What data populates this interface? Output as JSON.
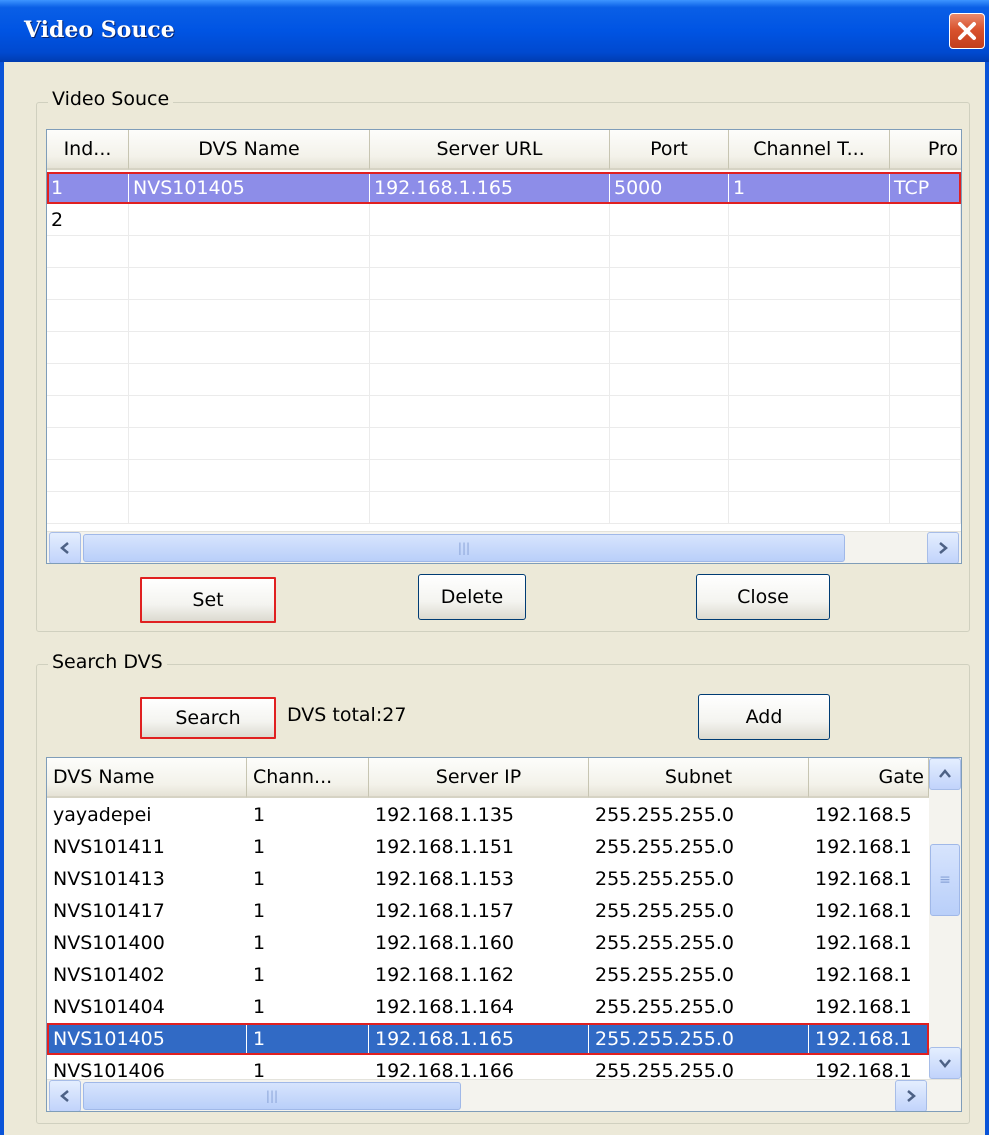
{
  "window": {
    "title": "Video Souce",
    "close_icon": "close-icon"
  },
  "video_source": {
    "group_label": "Video Souce",
    "columns": [
      "Ind...",
      "DVS Name",
      "Server URL",
      "Port",
      "Channel T...",
      "Pro"
    ],
    "rows": [
      [
        "1",
        "NVS101405",
        "192.168.1.165",
        "5000",
        "1",
        "TCP"
      ],
      [
        "2",
        "",
        "",
        "",
        "",
        ""
      ]
    ],
    "selected_row": 1,
    "empty_rows": 9,
    "buttons": {
      "set": "Set",
      "delete": "Delete",
      "close": "Close"
    },
    "scroll_grip": "|||"
  },
  "search_dvs": {
    "group_label": "Search DVS",
    "search_label": "Search",
    "total_text": "DVS total:27",
    "add_label": "Add",
    "columns": [
      "DVS Name",
      "Chann...",
      "Server IP",
      "Subnet",
      "Gate"
    ],
    "rows": [
      [
        "yayadepei",
        "1",
        "192.168.1.135",
        "255.255.255.0",
        "192.168.5"
      ],
      [
        "NVS101411",
        "1",
        "192.168.1.151",
        "255.255.255.0",
        "192.168.1"
      ],
      [
        "NVS101413",
        "1",
        "192.168.1.153",
        "255.255.255.0",
        "192.168.1"
      ],
      [
        "NVS101417",
        "1",
        "192.168.1.157",
        "255.255.255.0",
        "192.168.1"
      ],
      [
        "NVS101400",
        "1",
        "192.168.1.160",
        "255.255.255.0",
        "192.168.1"
      ],
      [
        "NVS101402",
        "1",
        "192.168.1.162",
        "255.255.255.0",
        "192.168.1"
      ],
      [
        "NVS101404",
        "1",
        "192.168.1.164",
        "255.255.255.0",
        "192.168.1"
      ],
      [
        "NVS101405",
        "1",
        "192.168.1.165",
        "255.255.255.0",
        "192.168.1"
      ],
      [
        "NVS101406",
        "1",
        "192.168.1.166",
        "255.255.255.0",
        "192.168.1"
      ]
    ],
    "selected_row": 8,
    "scroll_grip": "|||"
  },
  "colors": {
    "titlebar": "#0054e3",
    "selection_top": "#8d8de8",
    "selection_bottom": "#316ac5",
    "focus_outline": "#e02020"
  }
}
